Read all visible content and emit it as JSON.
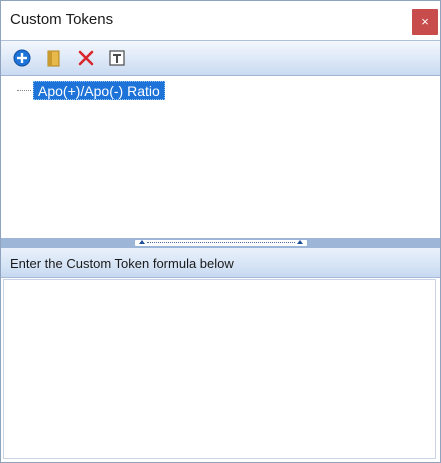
{
  "window": {
    "title": "Custom Tokens",
    "close_label": "×"
  },
  "toolbar": {
    "buttons": [
      {
        "name": "add-token-button",
        "icon": "plus-circle-icon",
        "color": "#1e73d9"
      },
      {
        "name": "open-token-button",
        "icon": "folder-icon",
        "color": "#e7b84a"
      },
      {
        "name": "delete-token-button",
        "icon": "red-x-icon",
        "color": "#d9262c"
      },
      {
        "name": "text-format-button",
        "icon": "text-t-icon",
        "color": "#4a4a4a"
      }
    ]
  },
  "tree": {
    "items": [
      {
        "label": "Apo(+)/Apo(-) Ratio",
        "selected": true
      }
    ]
  },
  "formula": {
    "header_label": "Enter the Custom Token formula below",
    "value": ""
  },
  "colors": {
    "selection": "#1e73d9",
    "close_button": "#c84c4c",
    "splitter": "#9db5d6"
  }
}
